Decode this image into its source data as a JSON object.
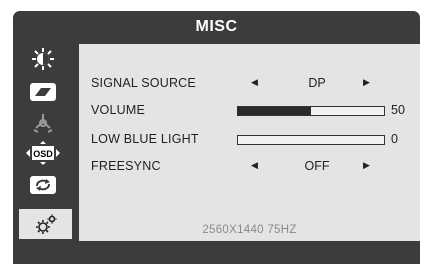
{
  "menu": {
    "title": "MISC"
  },
  "sidebar": {
    "items": [
      {
        "name": "brightness-icon"
      },
      {
        "name": "image-icon"
      },
      {
        "name": "color-icon"
      },
      {
        "name": "osd-icon",
        "label": "OSD"
      },
      {
        "name": "reset-icon"
      },
      {
        "name": "misc-settings-icon",
        "active": true
      }
    ]
  },
  "settings": {
    "signal_source": {
      "label": "SIGNAL SOURCE",
      "value": "DP"
    },
    "volume": {
      "label": "VOLUME",
      "value": "50",
      "level": 0.5
    },
    "low_blue_light": {
      "label": "LOW BLUE LIGHT",
      "value": "0",
      "level": 0
    },
    "freesync": {
      "label": "FREESYNC",
      "value": "OFF"
    }
  },
  "status": {
    "resolution": "2560X1440 75HZ"
  },
  "arrows": {
    "left": "◀",
    "right": "▶"
  }
}
